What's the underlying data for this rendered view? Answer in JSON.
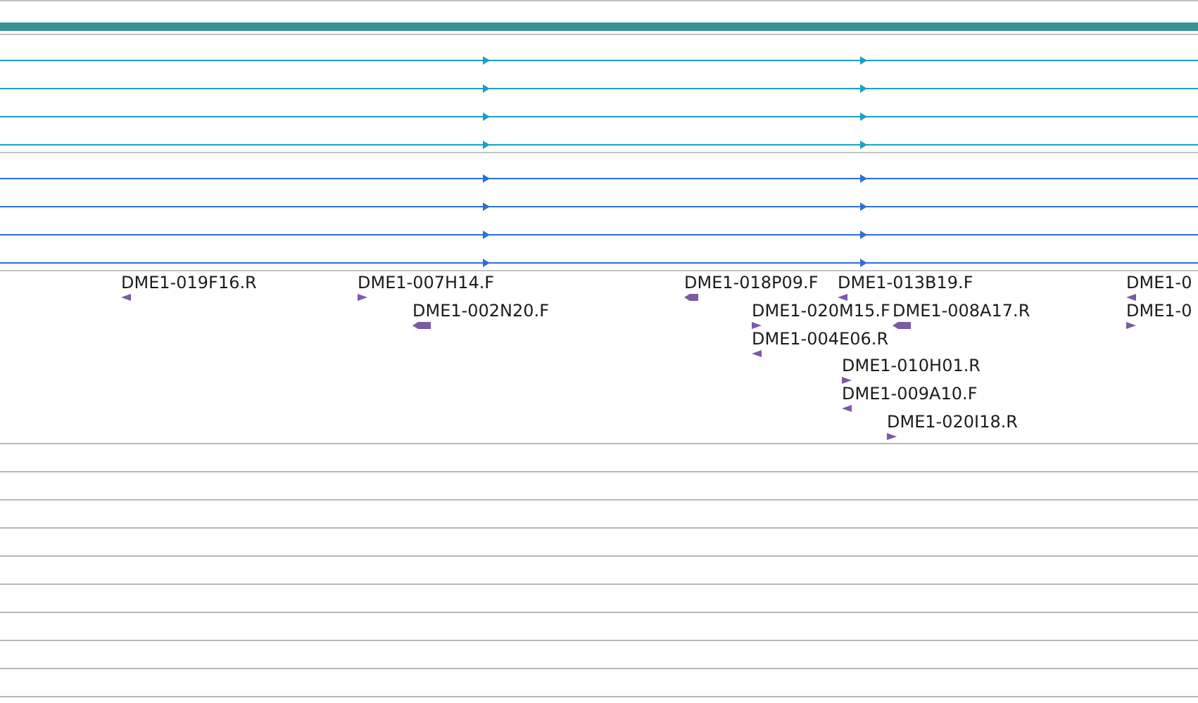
{
  "read_tracks": [
    {
      "color": "#1aa0c8"
    },
    {
      "color": "#2f6fd8"
    }
  ],
  "features": [
    {
      "label": "DME1-019F16.R",
      "reverse": true
    },
    {
      "label": "DME1-007H14.F",
      "reverse": false
    },
    {
      "label": "DME1-002N20.F",
      "reverse": true
    },
    {
      "label": "DME1-018P09.F",
      "reverse": true
    },
    {
      "label": "DME1-013B19.F",
      "reverse": true
    },
    {
      "label": "DME1-020M15.F",
      "reverse": false
    },
    {
      "label": "DME1-008A17.R",
      "reverse": true
    },
    {
      "label": "DME1-004E06.R",
      "reverse": true
    },
    {
      "label": "DME1-010H01.R",
      "reverse": false
    },
    {
      "label": "DME1-009A10.F",
      "reverse": true
    },
    {
      "label": "DME1-020I18.R",
      "reverse": false
    },
    {
      "label": "DME1-0",
      "reverse": true
    },
    {
      "label": "DME1-0",
      "reverse": false
    }
  ]
}
